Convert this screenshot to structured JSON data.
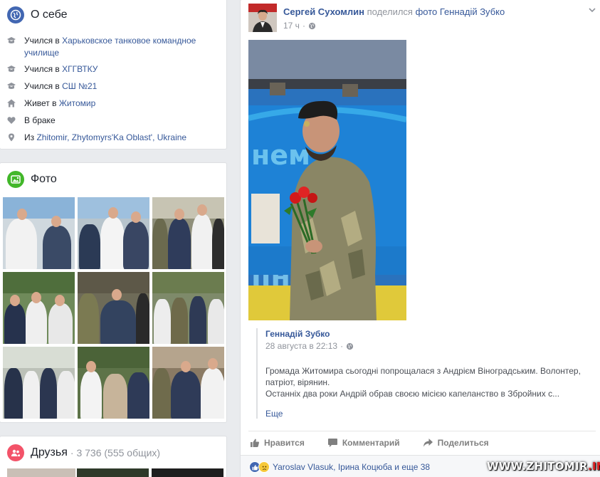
{
  "about": {
    "title": "О себе",
    "rows": [
      {
        "icon": "education-icon",
        "prefix": "Учился в ",
        "value": "Харьковское танковое командное училище"
      },
      {
        "icon": "education-icon",
        "prefix": "Учился в ",
        "value": "ХГГВТКУ"
      },
      {
        "icon": "education-icon",
        "prefix": "Учился в ",
        "value": "СШ №21"
      },
      {
        "icon": "home-icon",
        "prefix": "Живет в ",
        "value": "Житомир"
      },
      {
        "icon": "heart-icon",
        "prefix": "В браке",
        "value": ""
      },
      {
        "icon": "location-pin-icon",
        "prefix": "Из ",
        "value": "Zhitomir, Zhytomyrs'Ka Oblast', Ukraine"
      }
    ]
  },
  "photos": {
    "title": "Фото"
  },
  "friends": {
    "title": "Друзья",
    "count": "· 3 736 (555 общих)"
  },
  "post": {
    "author": "Сергей Сухомлин",
    "action": "поделился",
    "object": "фото Геннадій Зубко",
    "time": "17 ч",
    "shared": {
      "author": "Геннадій Зубко",
      "date": "28 августа в 22:13",
      "text": "Громада Житомира сьогодні попрощалася з Андрієм Віноградським. Волонтер, патріот, вірянин.\nОстанніх два роки Андрій обрав своєю місією капеланство в Збройних с...",
      "more": "Еще"
    },
    "actions": {
      "like": "Нравится",
      "comment": "Комментарий",
      "share": "Поделиться"
    },
    "reactions": "Yaroslav Vlasuk, Ірина Коцюба и еще 38"
  },
  "watermark": {
    "main": "WWW.ZHITOMIR",
    "tld": ".INFO"
  },
  "colors": {
    "link": "#365899",
    "grey": "#90949c",
    "brand": "#4267b2"
  }
}
